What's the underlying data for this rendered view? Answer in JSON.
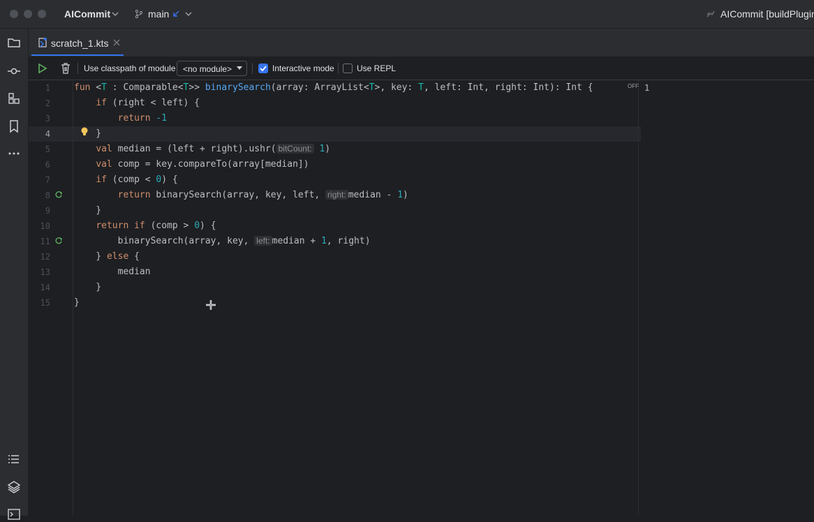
{
  "titlebar": {
    "project": "AICommit",
    "branch": "main",
    "right_title": "AICommit [buildPlugin"
  },
  "tab": {
    "file_name": "scratch_1.kts"
  },
  "toolbar": {
    "classpath_label": "Use classpath of module",
    "module_select": "<no module>",
    "interactive_label": "Interactive mode",
    "interactive_checked": true,
    "repl_label": "Use REPL",
    "repl_checked": false
  },
  "editor": {
    "result_off": "OFF",
    "result_value": "1",
    "line_numbers": [
      "1",
      "2",
      "3",
      "4",
      "5",
      "6",
      "7",
      "8",
      "9",
      "10",
      "11",
      "12",
      "13",
      "14",
      "15"
    ],
    "hints": {
      "bitcount": "bitCount:",
      "right": "right:",
      "left": "left:"
    }
  },
  "colors": {
    "accent": "#3574f0",
    "background": "#1e1f22",
    "keyword": "#cf8e6d",
    "function": "#56a8f5",
    "type_param": "#16baac",
    "number": "#2aacb8",
    "run_green": "#5fb865",
    "bulb_yellow": "#f2c55c"
  }
}
